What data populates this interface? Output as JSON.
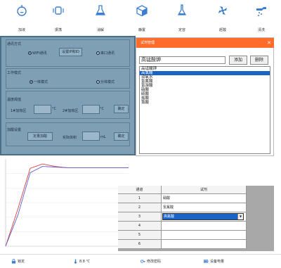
{
  "toolbar": {
    "items": [
      {
        "label": "加液",
        "icon": "beaker-add-icon"
      },
      {
        "label": "振荡",
        "icon": "shake-icon"
      },
      {
        "label": "消解",
        "icon": "flask-icon"
      },
      {
        "label": "静置",
        "icon": "cube-icon"
      },
      {
        "label": "定容",
        "icon": "volumetric-flask-icon"
      },
      {
        "label": "赶酸",
        "icon": "fan-icon"
      },
      {
        "label": "清洗",
        "icon": "rinse-icon"
      }
    ],
    "icon_color": "#3c7fd0"
  },
  "settings": {
    "comm": {
      "title": "通讯方式",
      "wifi": "WIFI通讯",
      "serial": "串口通讯",
      "set_button": "设置IP和ID"
    },
    "mode": {
      "title": "工作模式",
      "pre": "一体模式",
      "split": "分体模式"
    },
    "temp": {
      "title": "温度阈值",
      "zone1": "1#加热区",
      "zone2": "2#加热区",
      "unit": "°C",
      "confirm": "确定"
    },
    "acid": {
      "title": "加酸设置",
      "button": "定量加酸",
      "volume_label": "实际体积",
      "unit": "mL",
      "confirm": "确定"
    }
  },
  "dialog": {
    "title": "试剂管理",
    "close": "✕",
    "input_value": "高锰酸钾",
    "add": "添加",
    "delete": "删除",
    "list": [
      "高锰酸钾",
      "高氯酸",
      "双氧水",
      "氢氟酸",
      "氢溴酸",
      "硝酸",
      "硫酸",
      "盐酸",
      "氯酸"
    ],
    "selected_index": 1,
    "title_color": "#ff6b2a",
    "select_color": "#1a64c8"
  },
  "table": {
    "headers": [
      "通道",
      "试剂"
    ],
    "rows": [
      {
        "num": "1",
        "value": "硝酸"
      },
      {
        "num": "2",
        "value": "氢氟酸"
      },
      {
        "num": "3",
        "value": "高氯酸"
      },
      {
        "num": "4",
        "value": ""
      },
      {
        "num": "5",
        "value": ""
      },
      {
        "num": "6",
        "value": ""
      }
    ]
  },
  "status": {
    "items": [
      {
        "label": "锁定",
        "icon": "lock-icon"
      },
      {
        "label": "8.8 ℃",
        "icon": "thermometer-icon"
      },
      {
        "label": "修改密码",
        "icon": "key-icon"
      },
      {
        "label": "设备电量",
        "icon": "battery-icon"
      }
    ]
  },
  "chart_data": {
    "type": "line",
    "title": "",
    "xlabel": "",
    "ylabel": "",
    "series": [
      {
        "color": "#d84040",
        "values": [
          0,
          60,
          125,
          132,
          128,
          126,
          126,
          126,
          126,
          126,
          126
        ]
      },
      {
        "color": "#6060d0",
        "values": [
          0,
          50,
          118,
          128,
          127,
          126,
          126,
          126,
          126,
          126,
          126
        ]
      }
    ],
    "ylim": [
      0,
      140
    ],
    "grid": true
  }
}
